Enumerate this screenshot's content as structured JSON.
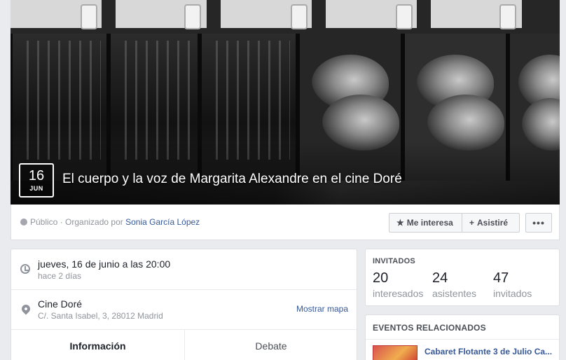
{
  "event": {
    "date_day": "16",
    "date_month": "JUN",
    "title": "El cuerpo y la voz de Margarita Alexandre en el cine Doré"
  },
  "infobar": {
    "privacy": "Público",
    "organized_prefix": "· Organizado por",
    "organizer": "Sonia García López",
    "interested_label": "Me interesa",
    "attend_label": "Asistiré",
    "more_label": "•••"
  },
  "details": {
    "when_main": "jueves, 16 de junio a las 20:00",
    "when_sub": "hace 2 días",
    "where_main": "Cine Doré",
    "where_sub": "C/. Santa Isabel, 3, 28012 Madrid",
    "map_link": "Mostrar mapa"
  },
  "tabs": [
    {
      "label": "Información",
      "active": true
    },
    {
      "label": "Debate",
      "active": false
    }
  ],
  "guests": {
    "header": "INVITADOS",
    "stats": [
      {
        "value": "20",
        "label": "interesados"
      },
      {
        "value": "24",
        "label": "asistentes"
      },
      {
        "value": "47",
        "label": "invitados"
      }
    ]
  },
  "related": {
    "header": "EVENTOS RELACIONADOS",
    "items": [
      {
        "title": "Cabaret Flotante 3 de Julio Ca...",
        "subtitle": ""
      }
    ]
  },
  "colors": {
    "link": "#365899",
    "accent": "#4267b2",
    "background": "#e9ebee"
  },
  "icons": [
    "globe-icon",
    "star-icon",
    "plus-icon",
    "more-icon",
    "clock-icon",
    "location-pin-icon"
  ]
}
